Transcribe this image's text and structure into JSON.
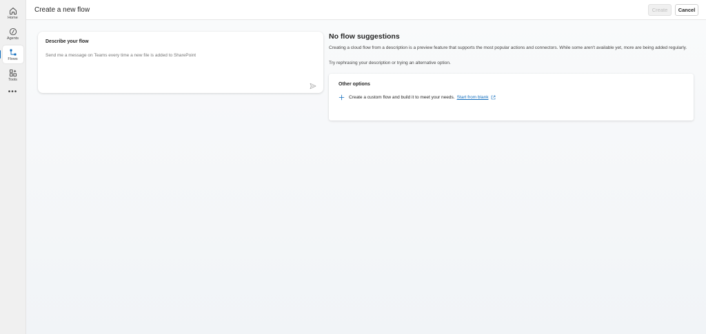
{
  "rail": {
    "items": [
      {
        "label": "Home",
        "icon": "home-icon"
      },
      {
        "label": "Agents",
        "icon": "agents-icon"
      },
      {
        "label": "Flows",
        "icon": "flows-icon",
        "active": true
      },
      {
        "label": "Tools",
        "icon": "tools-icon"
      }
    ],
    "more": "•••"
  },
  "header": {
    "title": "Create a new flow",
    "create_label": "Create",
    "cancel_label": "Cancel"
  },
  "describe": {
    "label": "Describe your flow",
    "placeholder": "Send me a message on Teams every time a new file is added to SharePoint"
  },
  "suggestions": {
    "title": "No flow suggestions",
    "description": "Creating a cloud flow from a description is a preview feature that supports the most popular actions and connectors. While some aren't available yet, more are being added regularly.",
    "hint": "Try rephrasing your description or trying an alternative option."
  },
  "other_options": {
    "title": "Other options",
    "custom_text": "Create a custom flow and build it to meet your needs.",
    "link_label": "Start from blank"
  },
  "colors": {
    "accent": "#0f6cbd",
    "rail_bg": "#f0f0f0"
  }
}
